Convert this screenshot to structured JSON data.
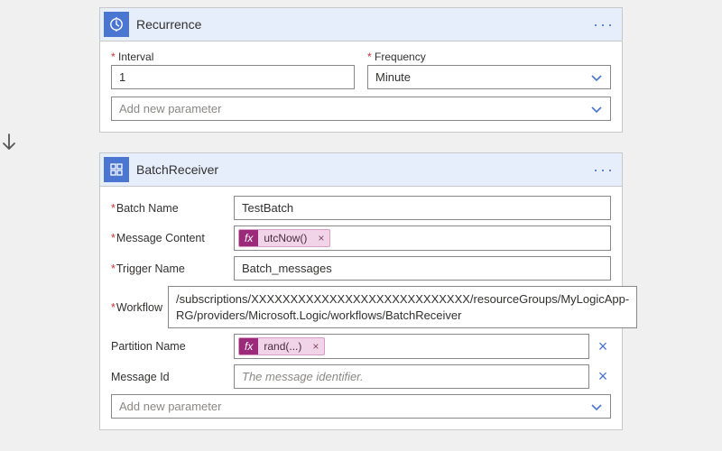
{
  "recurrence": {
    "title": "Recurrence",
    "interval_label": "Interval",
    "interval_value": "1",
    "frequency_label": "Frequency",
    "frequency_value": "Minute",
    "add_param": "Add new parameter"
  },
  "batch": {
    "title": "BatchReceiver",
    "add_param": "Add new parameter",
    "labels": {
      "batch_name": "Batch Name",
      "message_content": "Message Content",
      "trigger_name": "Trigger Name",
      "workflow": "Workflow",
      "partition_name": "Partition Name",
      "message_id": "Message Id"
    },
    "values": {
      "batch_name": "TestBatch",
      "message_content_token": "utcNow()",
      "trigger_name": "Batch_messages",
      "workflow": "/subscriptions/XXXXXXXXXXXXXXXXXXXXXXXXXXXX/resourceGroups/MyLogicApp-RG/providers/Microsoft.Logic/workflows/BatchReceiver",
      "partition_token": "rand(...)",
      "message_id_placeholder": "The message identifier."
    }
  },
  "fx_label": "fx"
}
